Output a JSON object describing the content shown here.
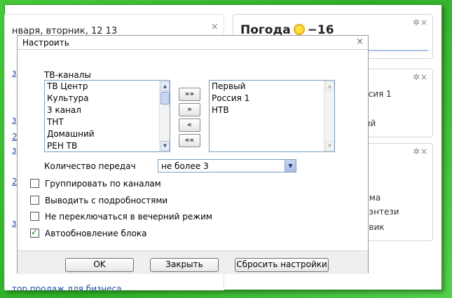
{
  "background": {
    "date_text": "нваря, вторник, 12 13",
    "close_glyph": "×",
    "left_links": [
      "з",
      "з",
      "2",
      "з",
      "2",
      "з"
    ],
    "bottom_link": "тор продаж для бизнеса",
    "weather": {
      "title": "Погода",
      "temp": "−16",
      "controls": "✲×"
    },
    "tv_widget": {
      "controls": "✲×",
      "lines": [
        "ссия 1",
        "ый"
      ]
    },
    "third_widget": {
      "controls": "✲×",
      "lines": [
        "има",
        "рэнтези",
        "евик"
      ]
    }
  },
  "dialog": {
    "title": "Настроить",
    "close_glyph": "×",
    "channels_label": "ТВ-каналы",
    "available_channels": [
      "ТВ Центр",
      "Культура",
      "3 канал",
      "ТНТ",
      "Домашний",
      "РЕН ТВ"
    ],
    "selected_channels": [
      "Первый",
      "Россия 1",
      "НТВ"
    ],
    "move_buttons": {
      "add_all": "»»",
      "add": "»",
      "remove": "«",
      "remove_all": "««"
    },
    "count_label": "Количество передач",
    "count_value": "не более 3",
    "checkboxes": [
      {
        "label": "Группировать по каналам",
        "checked": false
      },
      {
        "label": "Выводить с подробностями",
        "checked": false
      },
      {
        "label": "Не переключаться в вечерний режим",
        "checked": false
      },
      {
        "label": "Автообновление блока",
        "checked": true
      }
    ],
    "buttons": {
      "ok": "OK",
      "close": "Закрыть",
      "reset": "Сбросить настройки"
    }
  },
  "colors": {
    "frame_green": "#3fbd35",
    "link_blue": "#1f4fa8",
    "listbox_border": "#7f9db9"
  },
  "icons": {
    "scroll_up": "▲",
    "scroll_down": "▼",
    "dropdown": "▼",
    "gear": "✲",
    "close": "×",
    "sun": "sun-icon"
  }
}
